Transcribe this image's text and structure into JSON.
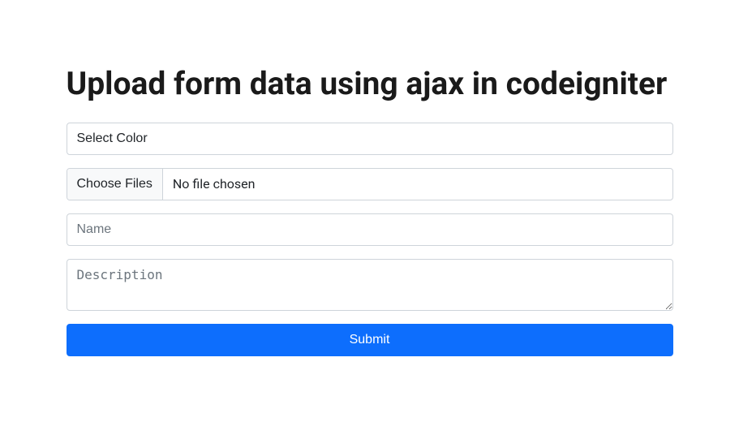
{
  "page": {
    "title": "Upload form data using ajax in codeigniter"
  },
  "form": {
    "color_select": {
      "selected_label": "Select Color"
    },
    "file_input": {
      "button_label": "Choose Files",
      "status_text": "No file chosen"
    },
    "name_input": {
      "placeholder": "Name",
      "value": ""
    },
    "description_textarea": {
      "placeholder": "Description",
      "value": ""
    },
    "submit_button": {
      "label": "Submit"
    }
  }
}
